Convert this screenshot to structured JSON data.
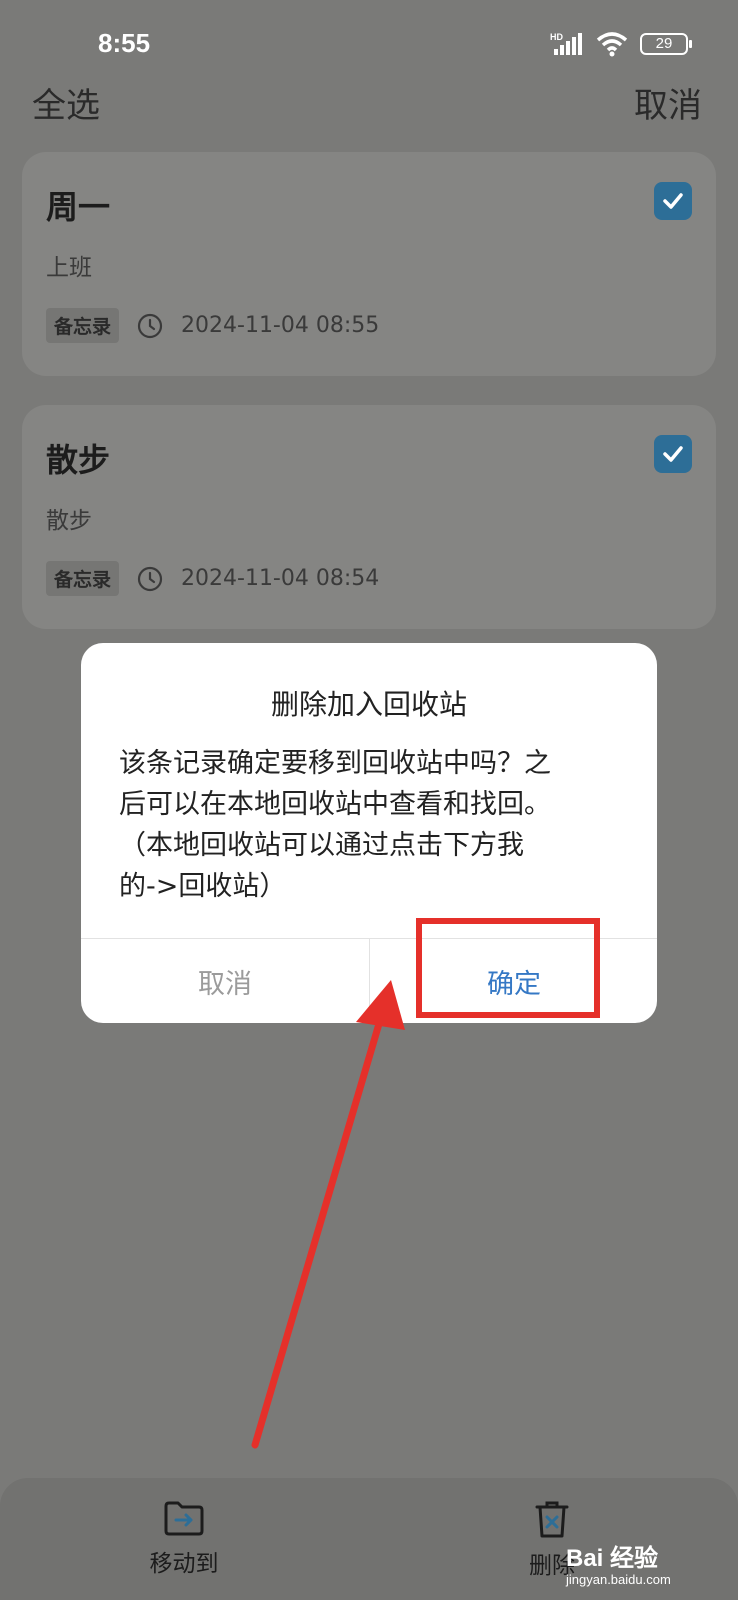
{
  "status": {
    "time": "8:55",
    "battery": "29",
    "network": "HD"
  },
  "topbar": {
    "select_all": "全选",
    "cancel": "取消"
  },
  "notes": [
    {
      "title": "周一",
      "body": "上班",
      "tag": "备忘录",
      "date": "2024-11-04 08:55",
      "checked": true
    },
    {
      "title": "散步",
      "body": "散步",
      "tag": "备忘录",
      "date": "2024-11-04 08:54",
      "checked": true
    }
  ],
  "dialog": {
    "title": "删除加入回收站",
    "message_lines": [
      "该条记录确定要移到回收站中吗？之",
      "后可以在本地回收站中查看和找回。",
      "（本地回收站可以通过点击下方我",
      "的->回收站）"
    ],
    "cancel": "取消",
    "confirm": "确定"
  },
  "bottom_bar": {
    "move_to": "移动到",
    "delete": "删除"
  },
  "watermark": {
    "brand": "Bai 经验",
    "url": "jingyan.baidu.com"
  },
  "colors": {
    "checkbox": "#2d6e97",
    "confirm": "#3578c5",
    "highlight": "#e5302a"
  },
  "icons": [
    "signal-icon",
    "wifi-icon",
    "battery-icon",
    "clock-icon",
    "check-icon",
    "folder-move-icon",
    "trash-icon"
  ]
}
